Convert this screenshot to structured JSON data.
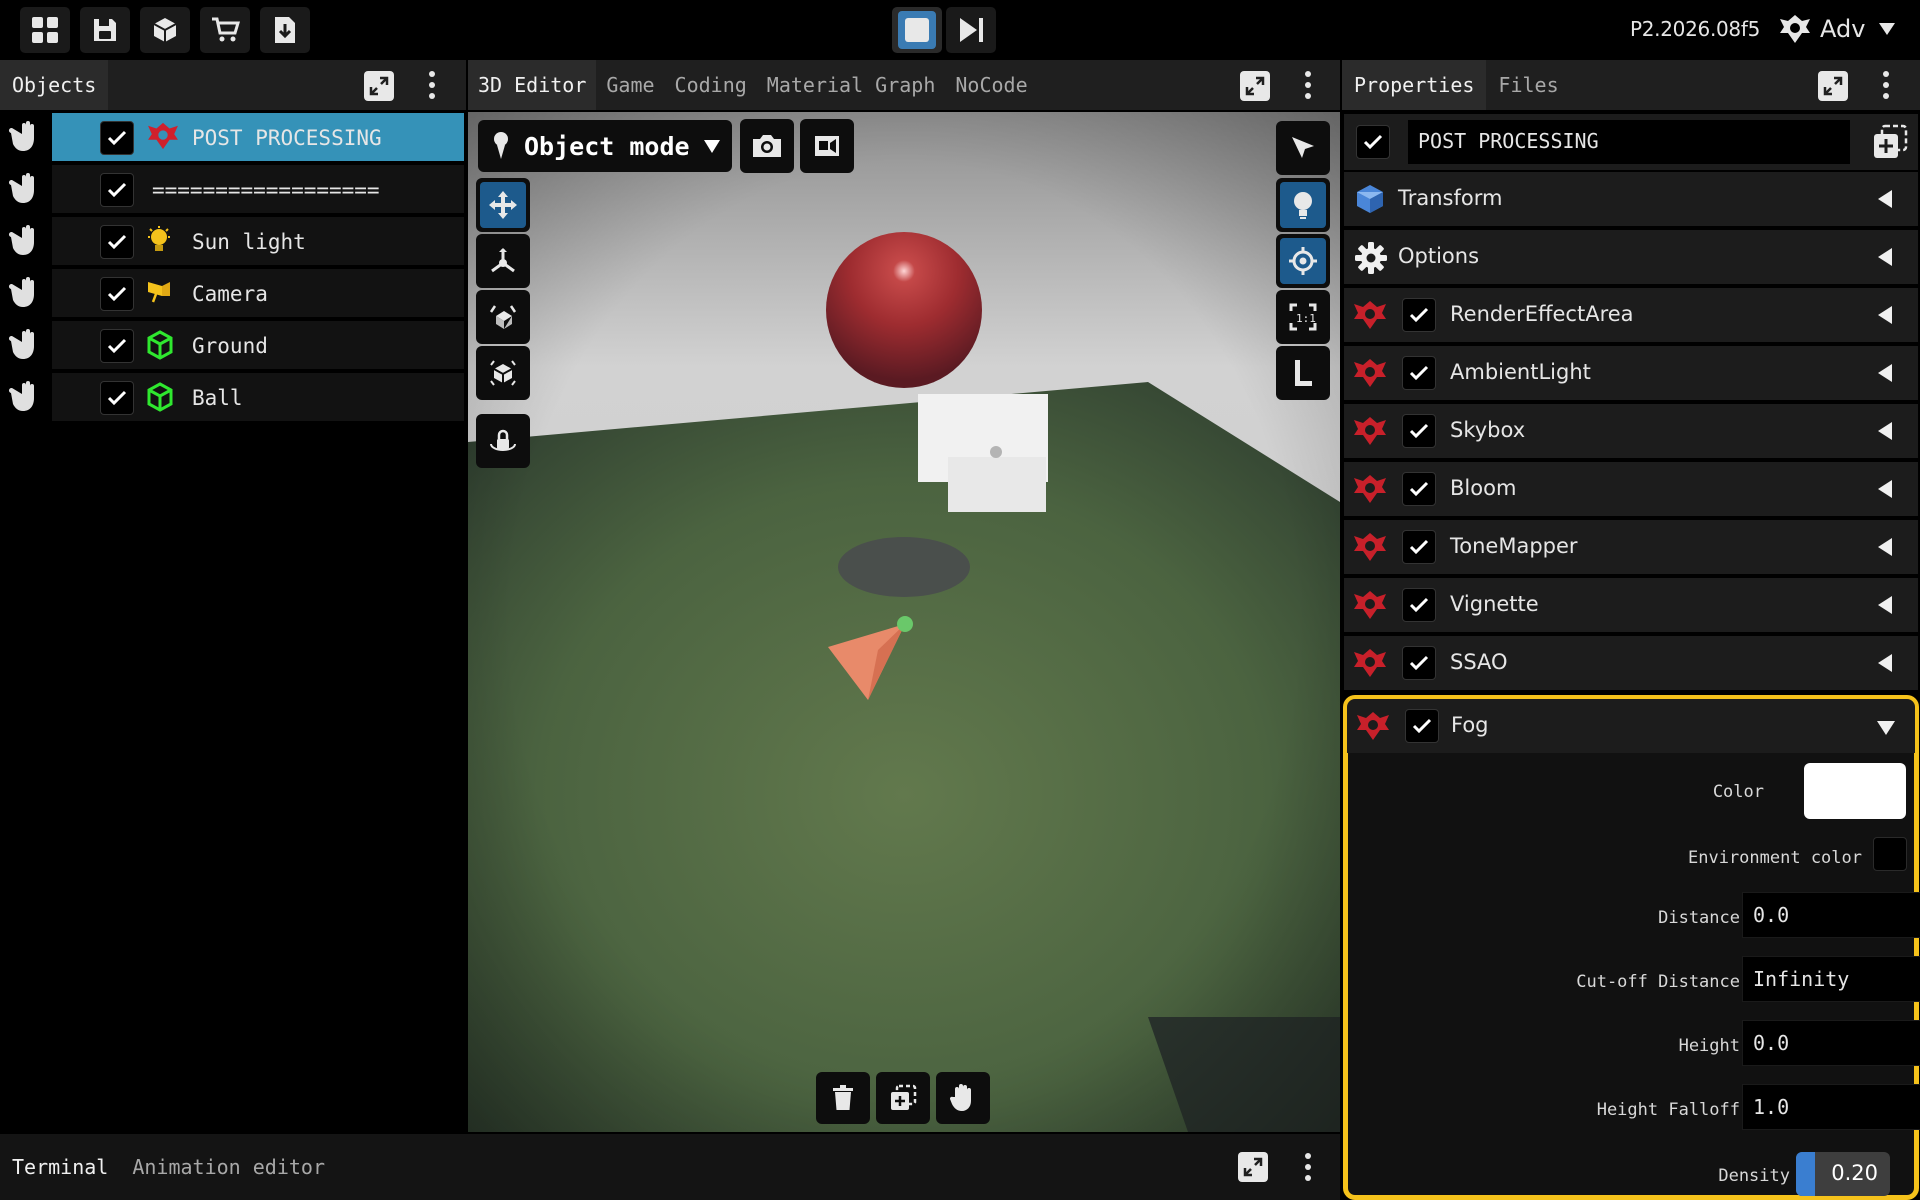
{
  "app": {
    "version": "P2.2026.08f5",
    "user_label": "Adv",
    "accent": "#3592b8",
    "highlight": "#f5c21b"
  },
  "toolbar": {
    "icons": [
      "grid-icon",
      "save-icon",
      "cube-icon",
      "cart-icon",
      "download-icon"
    ],
    "center_icons": [
      "stop-icon",
      "step-forward-icon"
    ]
  },
  "outliner": {
    "tab_label": "Objects",
    "items": [
      {
        "label": "POST PROCESSING",
        "icon": "post-processing-icon",
        "selected": true,
        "checked": true
      },
      {
        "label": "==================",
        "icon": "",
        "selected": false,
        "checked": true
      },
      {
        "label": "Sun light",
        "icon": "bulb-icon",
        "selected": false,
        "checked": true
      },
      {
        "label": "Camera",
        "icon": "camera-icon",
        "selected": false,
        "checked": true
      },
      {
        "label": "Ground",
        "icon": "mesh-icon",
        "selected": false,
        "checked": true
      },
      {
        "label": "Ball",
        "icon": "mesh-icon",
        "selected": false,
        "checked": true
      }
    ]
  },
  "editor": {
    "tabs": [
      "3D Editor",
      "Game",
      "Coding",
      "Material Graph",
      "NoCode"
    ],
    "active_tab": "3D Editor",
    "mode_label": "Object mode"
  },
  "properties": {
    "tabs": [
      "Properties",
      "Files"
    ],
    "active_tab": "Properties",
    "object_name": "POST PROCESSING",
    "sections": [
      "Transform",
      "Options"
    ],
    "effects": [
      "RenderEffectArea",
      "AmbientLight",
      "Skybox",
      "Bloom",
      "ToneMapper",
      "Vignette",
      "SSAO"
    ],
    "fog": {
      "title": "Fog",
      "color_label": "Color",
      "color_value": "#ffffff",
      "env_color_label": "Environment color",
      "env_color_value": "#000000",
      "distance_label": "Distance",
      "distance_value": "0.0",
      "cutoff_label": "Cut-off Distance",
      "cutoff_value": "Infinity",
      "height_label": "Height",
      "height_value": "0.0",
      "falloff_label": "Height Falloff",
      "falloff_value": "1.0",
      "density_label": "Density",
      "density_value": "0.20",
      "density_fraction": 0.2
    }
  },
  "bottom": {
    "tabs": [
      "Terminal",
      "Animation editor"
    ],
    "active_tab": "Terminal"
  }
}
